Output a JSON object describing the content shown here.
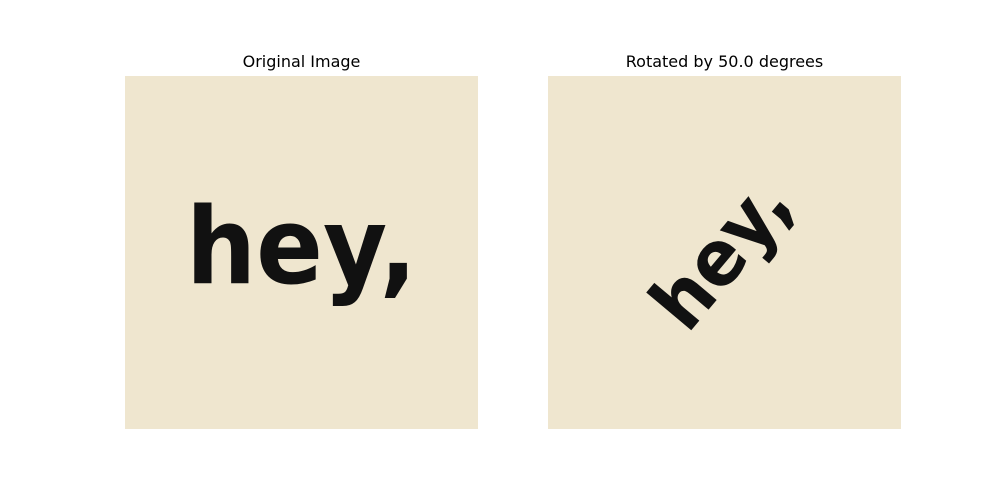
{
  "panels": [
    {
      "title": "Original Image",
      "text": "hey,",
      "rotation_degrees": 0
    },
    {
      "title": "Rotated by 50.0 degrees",
      "text": "hey,",
      "rotation_degrees": 50.0
    }
  ],
  "colors": {
    "background": "#efe6cf",
    "ink": "#111111"
  }
}
